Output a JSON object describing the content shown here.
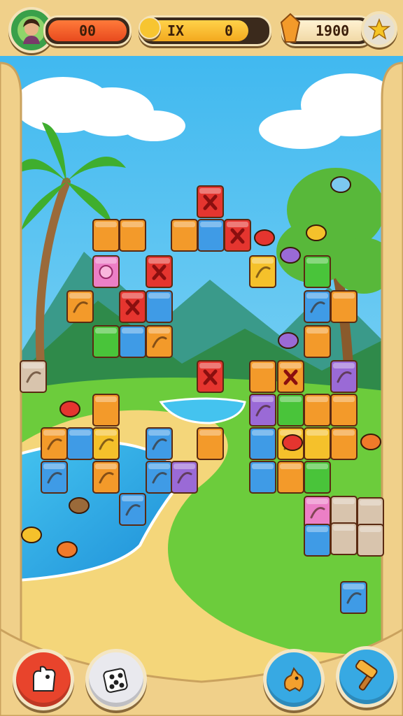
{
  "hud": {
    "player_avatar_icon": "player-portrait",
    "player_score": "00",
    "coin_icon": "gold-coin",
    "coin_label": "IX",
    "coin_count": "0",
    "gem_icon": "orange-crystal",
    "gem_count": "1900",
    "star_icon": "star"
  },
  "bottom_bar": {
    "left_buttons": [
      {
        "icon": "glove-hand-icon",
        "color": "#e8442c"
      },
      {
        "icon": "dice-icon",
        "color": "#e9e9ee"
      }
    ],
    "right_buttons": [
      {
        "icon": "animal-icon",
        "color": "#37a9e3"
      },
      {
        "icon": "hammer-icon",
        "color": "#37a9e3"
      }
    ]
  },
  "board": {
    "tile_colors": {
      "orange": "#f39a2a",
      "red": "#e5352f",
      "blue": "#3f9be6",
      "green": "#49c43a",
      "yellow": "#f5c12b",
      "purple": "#9a6ad6",
      "pink": "#ec7fc6",
      "stone": "#d8c4ad"
    }
  }
}
